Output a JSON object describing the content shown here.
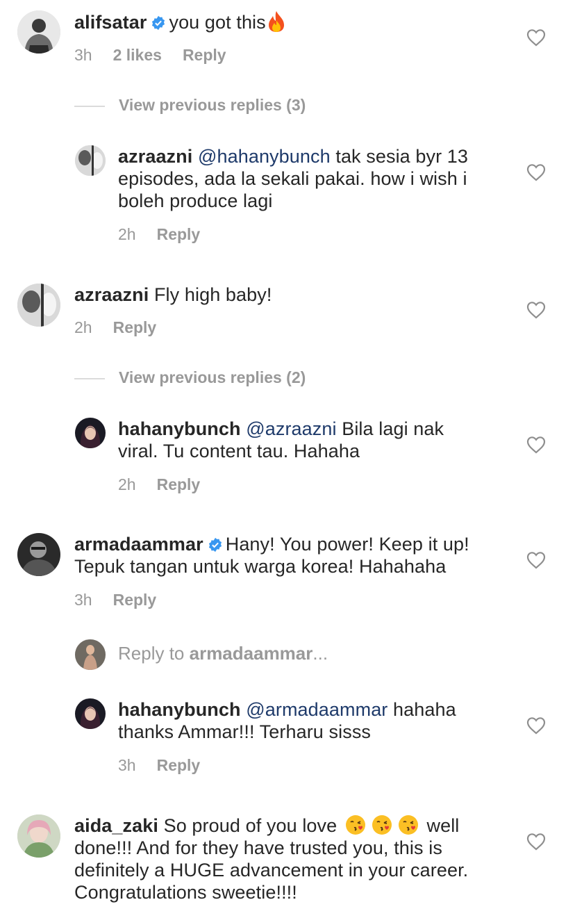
{
  "comments": [
    {
      "username": "alifsatar",
      "verified": true,
      "text": "you got this",
      "time": "3h",
      "likes": "2 likes",
      "reply": "Reply"
    },
    {
      "view_previous": "View previous replies (3)"
    },
    {
      "username": "azraazni",
      "mention": "@hahanybunch",
      "text_l1": "tak sesia byr 13",
      "text_l2": "episodes, ada la sekali pakai. how i wish i",
      "text_l3": "boleh produce lagi",
      "time": "2h",
      "reply": "Reply"
    },
    {
      "username": "azraazni",
      "text": "Fly high baby!",
      "time": "2h",
      "reply": "Reply"
    },
    {
      "view_previous": "View previous replies (2)"
    },
    {
      "username": "hahanybunch",
      "mention": "@azraazni",
      "text_l1": "Bila lagi nak",
      "text_l2": "viral. Tu content tau. Hahaha",
      "time": "2h",
      "reply": "Reply"
    },
    {
      "username": "armadaammar",
      "verified": true,
      "text_l1": "Hany! You power! Keep it up!",
      "text_l2": "Tepuk tangan untuk warga korea! Hahahaha",
      "time": "3h",
      "reply": "Reply"
    },
    {
      "reply_to_prefix": "Reply to ",
      "reply_to_user": "armadaammar",
      "reply_to_suffix": "..."
    },
    {
      "username": "hahanybunch",
      "mention": "@armadaammar",
      "text_l1": "hahaha",
      "text_l2": "thanks Ammar!!! Terharu sisss",
      "time": "3h",
      "reply": "Reply"
    },
    {
      "username": "aida_zaki",
      "text_l1a": "So proud of you love",
      "text_l1b": "well",
      "text_l2": "done!!! And for they have trusted you, this is",
      "text_l3": "definitely a HUGE advancement in your career.",
      "text_l4": "Congratulations sweetie!!!!"
    }
  ],
  "icons": {
    "heart": "heart-outline-icon",
    "verified": "verified-badge-icon",
    "fire": "fire-emoji",
    "kiss": "kissing-face-emoji"
  },
  "colors": {
    "username": "#262626",
    "meta": "#999999",
    "mention": "#1e3a6a",
    "verified": "#3897f0"
  }
}
